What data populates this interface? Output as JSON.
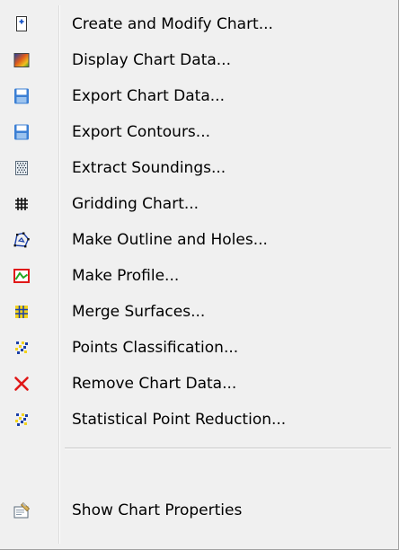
{
  "menu": {
    "items": [
      {
        "label": "Create and Modify Chart...",
        "icon": "new-chart-icon"
      },
      {
        "label": "Display Chart Data...",
        "icon": "gradient-display-icon"
      },
      {
        "label": "Export Chart Data...",
        "icon": "floppy-disk-icon"
      },
      {
        "label": "Export Contours...",
        "icon": "floppy-disk-icon"
      },
      {
        "label": "Extract Soundings...",
        "icon": "soundings-icon"
      },
      {
        "label": "Gridding Chart...",
        "icon": "grid-icon"
      },
      {
        "label": "Make Outline and Holes...",
        "icon": "outline-polygon-icon"
      },
      {
        "label": "Make Profile...",
        "icon": "profile-icon"
      },
      {
        "label": "Merge Surfaces...",
        "icon": "merge-surfaces-icon"
      },
      {
        "label": "Points Classification...",
        "icon": "points-icon"
      },
      {
        "label": "Remove Chart Data...",
        "icon": "remove-x-icon"
      },
      {
        "label": "Statistical Point Reduction...",
        "icon": "points-icon"
      }
    ],
    "footer_item": {
      "label": "Show Chart Properties",
      "icon": "properties-icon"
    }
  },
  "colors": {
    "menu_background": "#f0f0f0",
    "text": "#000000",
    "remove_red": "#e01818",
    "profile_red": "#e01818",
    "profile_green": "#22aa22",
    "floppy_blue": "#3b7fd4"
  }
}
